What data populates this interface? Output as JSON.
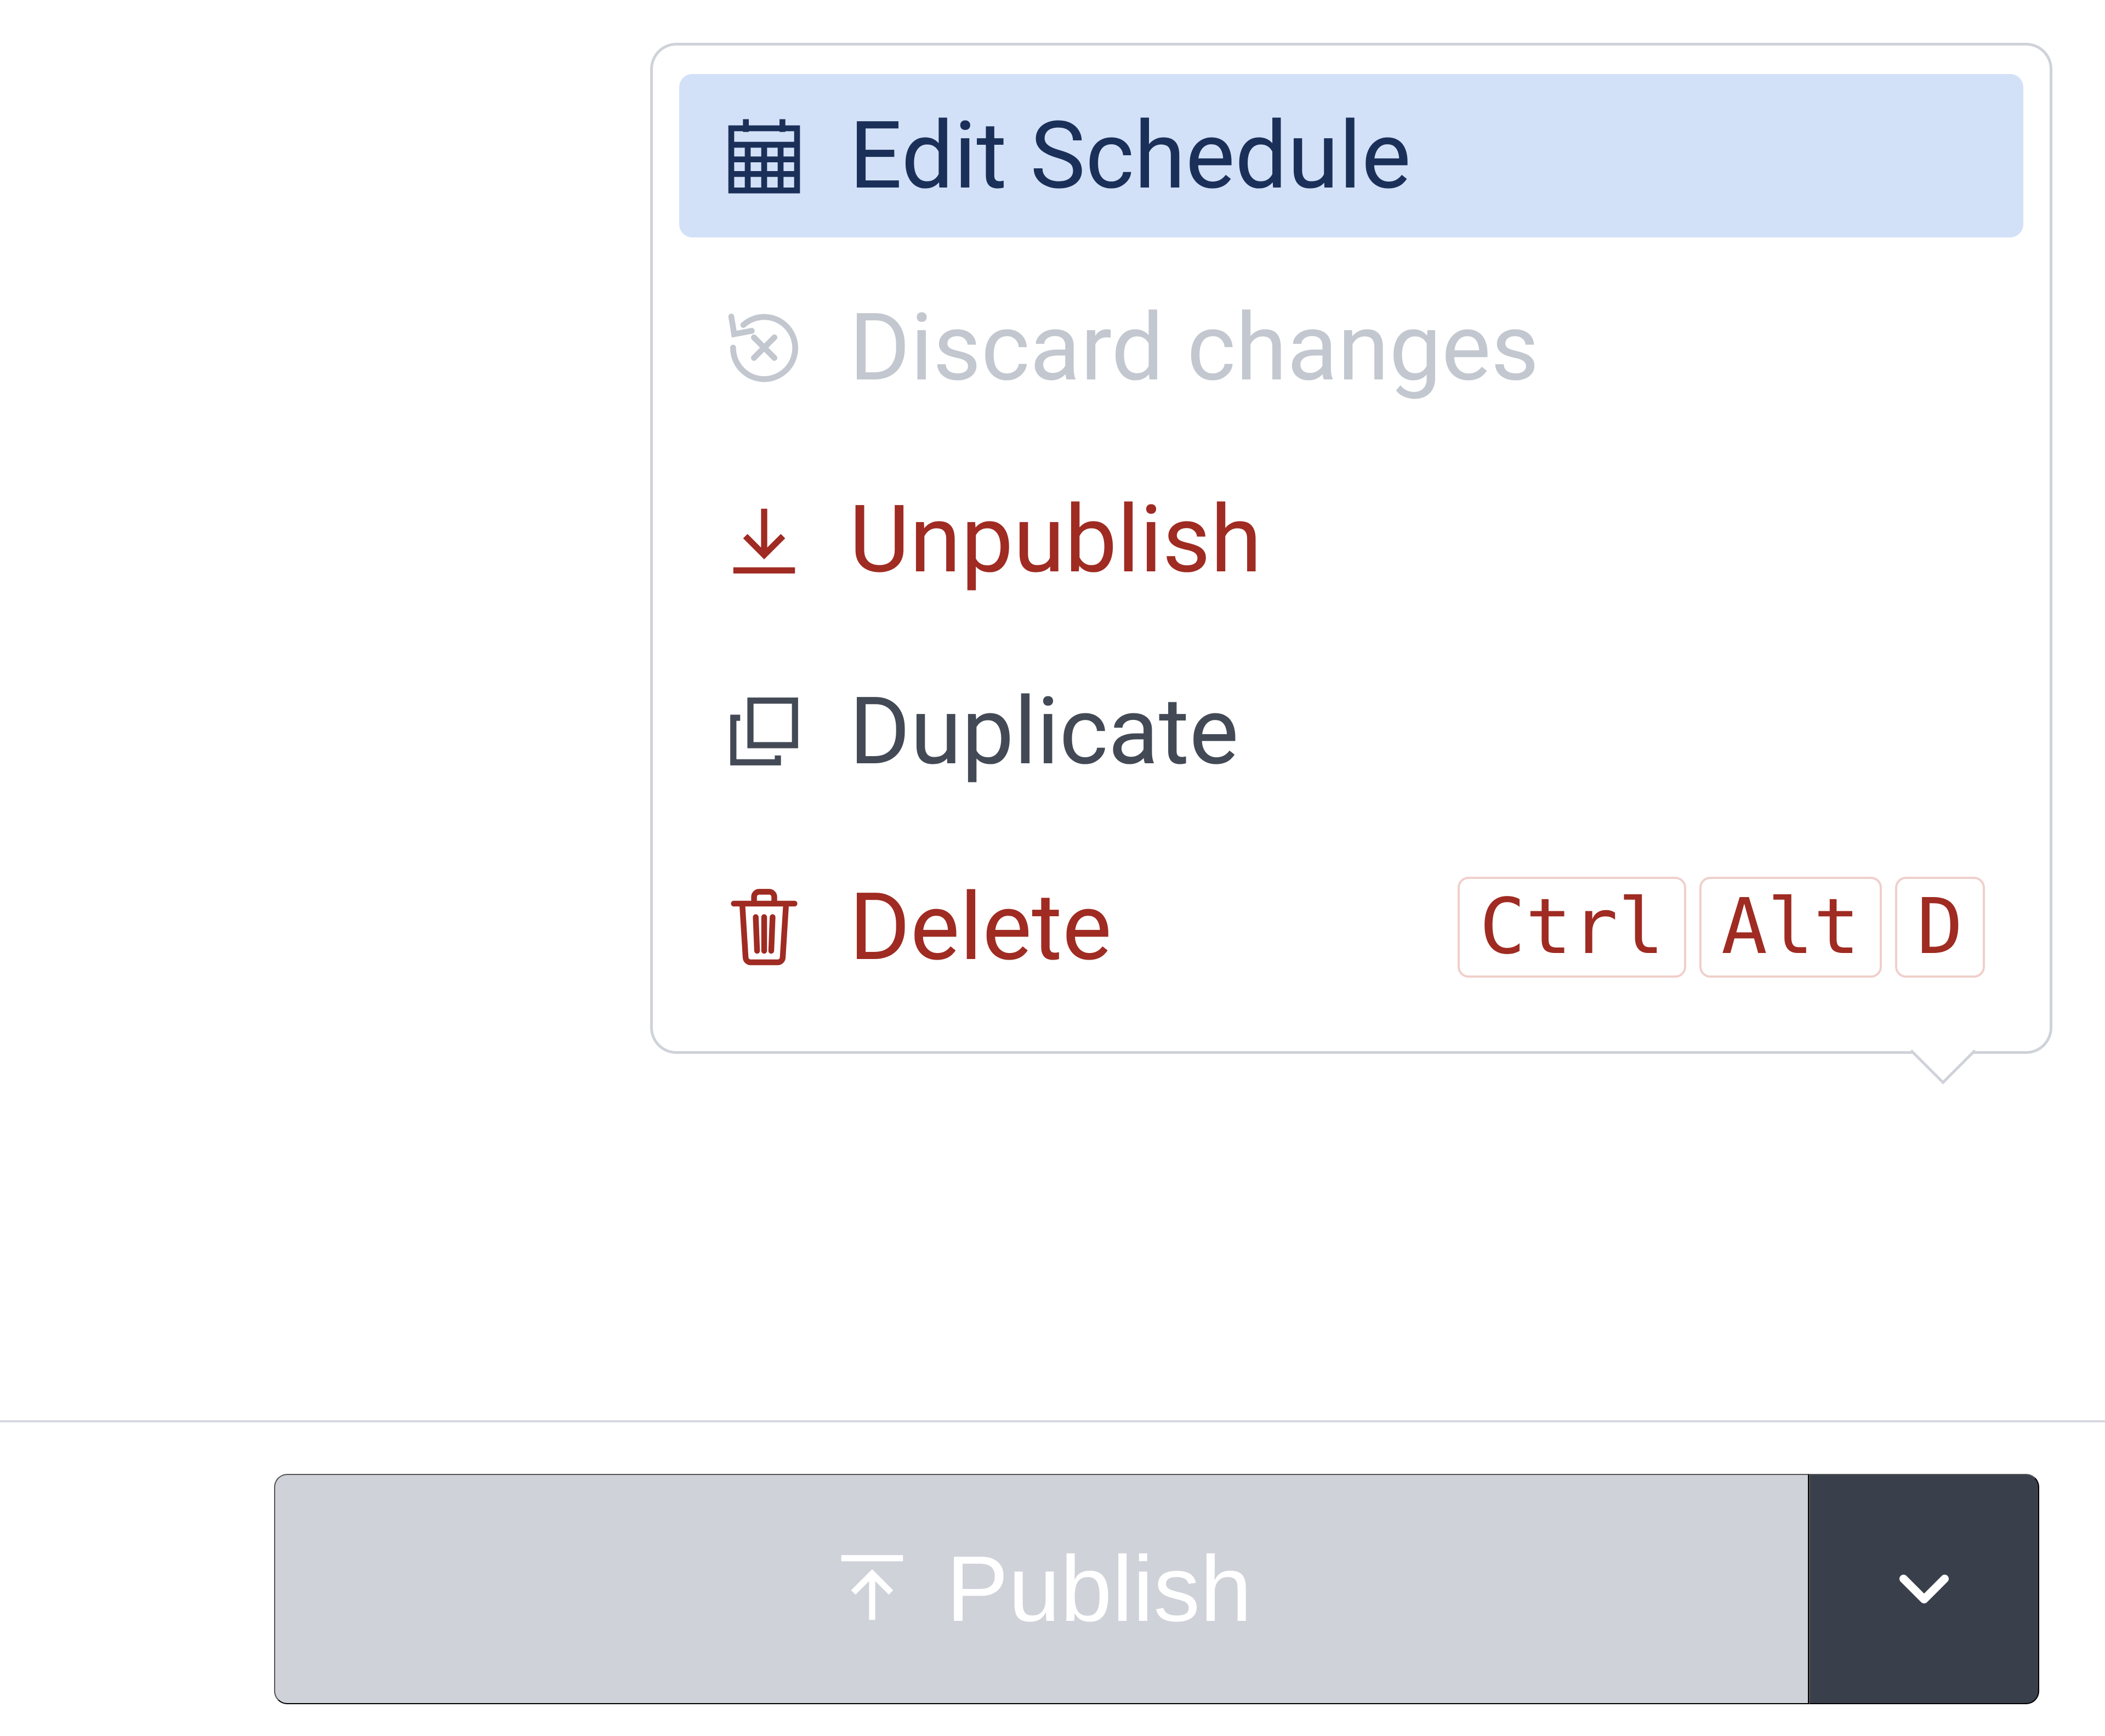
{
  "menu": {
    "items": [
      {
        "label": "Edit Schedule"
      },
      {
        "label": "Discard changes"
      },
      {
        "label": "Unpublish"
      },
      {
        "label": "Duplicate"
      },
      {
        "label": "Delete",
        "shortcut": [
          "Ctrl",
          "Alt",
          "D"
        ]
      }
    ]
  },
  "publish": {
    "label": "Publish"
  }
}
